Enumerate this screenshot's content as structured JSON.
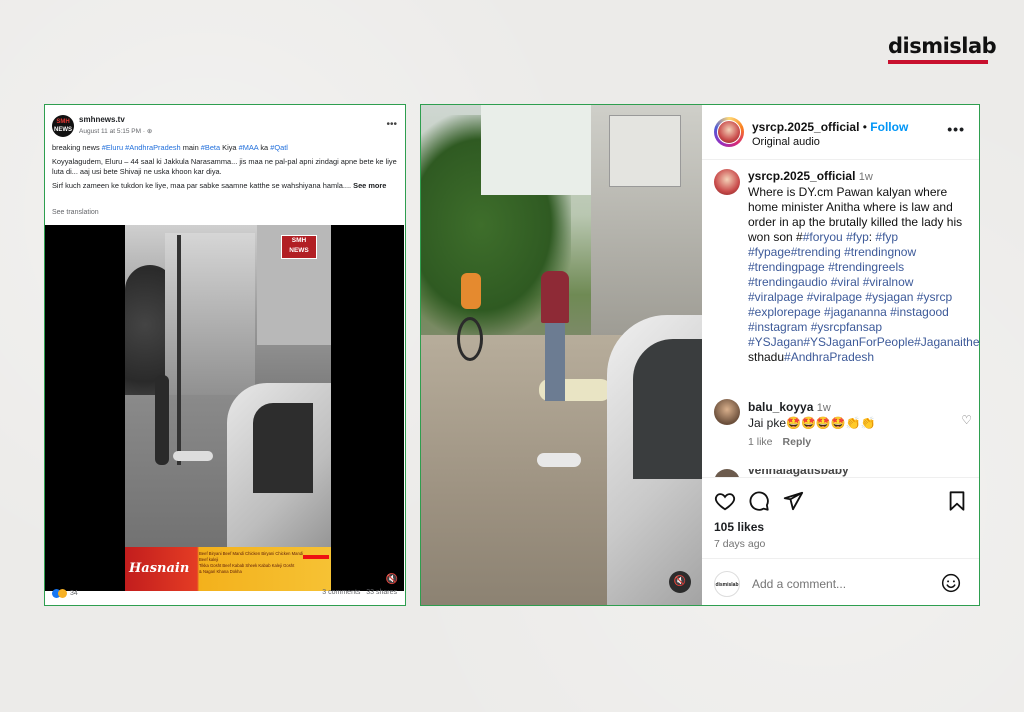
{
  "brand": {
    "name": "dismislab"
  },
  "facebook": {
    "page_name": "smhnews.tv",
    "post_date": "August 11 at 5:15 PM",
    "avatar_text": [
      "SMH",
      "NEWS"
    ],
    "line1": {
      "prefix": "breaking news  ",
      "tags": [
        "#Eluru",
        "#AndhraPradesh"
      ],
      "mid1": " main ",
      "tag3": "#Beta",
      "mid2": " Kiya ",
      "tag4": "#MAA",
      "mid3": " ka ",
      "tag5": "#Qatl"
    },
    "line2": "Koyyalagudem, Eluru – 44 saal ki Jakkula Narasamma... jis maa ne pal-pal apni zindagi apne bete ke liye luta di... aaj usi bete Shivaji ne uska khoon kar diya.",
    "line3": "Sirf kuch zameen ke tukdon ke liye, maa par sabke saamne katthe se wahshiyana hamla....",
    "see_more": "See more",
    "see_translation": "See translation",
    "video_logo": [
      "SMH",
      "NEWS"
    ],
    "ad": {
      "title": "Hasnain",
      "small_text": [
        "Beef Biryani   Beef Mandi   Chicken Biryani   Chicken Mandi",
        "Beef kaleji",
        "Tikka Gosht Beef Kabab Sheek Kabab Kaleji Gosht",
        "& Nagari Khana Dokha"
      ]
    },
    "reaction_count": "34",
    "comments": "3 comments",
    "shares": "33 shares"
  },
  "instagram": {
    "username": "ysrcp.2025_official",
    "separator": "•",
    "follow": "Follow",
    "audio": "Original audio",
    "caption_time": "1w",
    "caption_text": "Where is DY.cm Pawan kalyan where home minister Anitha where is law and order in ap the brutally killed the lady his won son #",
    "caption_tags_a": "#foryou #fyp",
    "caption_colon": ": ",
    "caption_tags_b": "#fyp #fypage#trending #trendingnow #trendingpage #trendingreels #trendingaudio #viral #viralnow #viralpage #viralpage #ysjagan #ysrcp #explorepage #jagananna #instagood #instagram #ysrcpfansap #YSJagan#YSJaganForPeople#JaganaitheneChe",
    "caption_tail": "sthadu",
    "caption_last_tag": "#AndhraPradesh",
    "comment": {
      "user": "balu_koyya",
      "time": "1w",
      "text": "Jai pke🤩🤩🤩🤩👏👏",
      "likes": "1 like",
      "reply": "Reply"
    },
    "next_comment_user": "vennalagatisbaby",
    "likes": "105 likes",
    "age": "7 days ago",
    "add_comment_placeholder": "Add a comment...",
    "self_avatar": "dismislab"
  },
  "colors": {
    "border": "#2e9e4f",
    "brand_red": "#c8102e",
    "fb_tag": "#216fdb",
    "ig_follow": "#0095f6"
  }
}
